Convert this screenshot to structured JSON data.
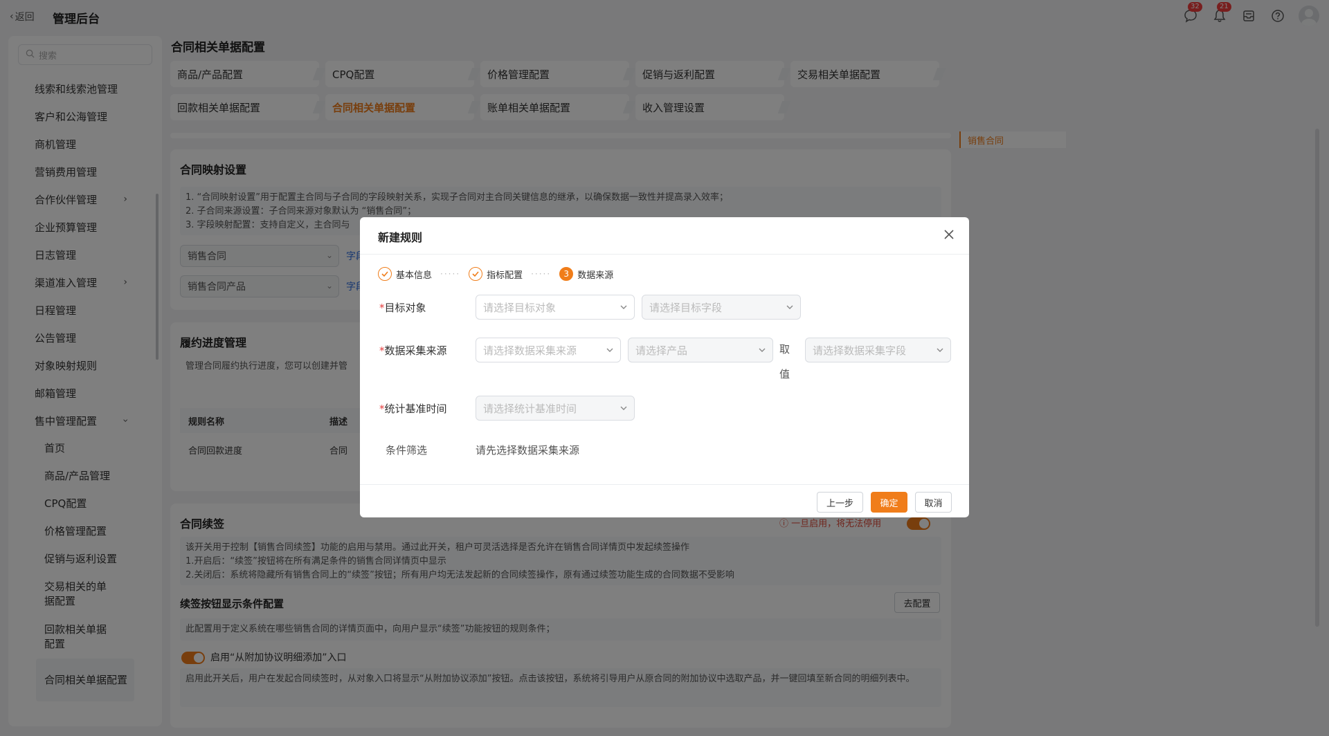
{
  "topbar": {
    "back_label": "返回",
    "app_title": "管理后台",
    "chat_badge": "32",
    "bell_badge": "21"
  },
  "sidebar": {
    "search_placeholder": "搜索",
    "items": [
      {
        "label": "线索和线索池管理"
      },
      {
        "label": "客户和公海管理"
      },
      {
        "label": "商机管理"
      },
      {
        "label": "营销费用管理"
      },
      {
        "label": "合作伙伴管理"
      },
      {
        "label": "企业预算管理"
      },
      {
        "label": "日志管理"
      },
      {
        "label": "渠道准入管理"
      },
      {
        "label": "日程管理"
      },
      {
        "label": "公告管理"
      },
      {
        "label": "对象映射规则"
      },
      {
        "label": "邮箱管理"
      },
      {
        "label": "售中管理配置"
      }
    ],
    "sub_items": [
      {
        "label": "首页"
      },
      {
        "label": "商品/产品管理"
      },
      {
        "label": "CPQ配置"
      },
      {
        "label": "价格管理配置"
      },
      {
        "label": "促销与返利设置"
      },
      {
        "label": "交易相关的单据配置"
      },
      {
        "label": "回款相关单据配置"
      },
      {
        "label": "合同相关单据配置"
      }
    ],
    "collapse_glyph": "«"
  },
  "main": {
    "title": "合同相关单据配置",
    "tabs": [
      {
        "label": "商品/产品配置"
      },
      {
        "label": "CPQ配置"
      },
      {
        "label": "价格管理配置"
      },
      {
        "label": "促销与返利配置"
      },
      {
        "label": "交易相关单据配置"
      },
      {
        "label": "回款相关单据配置"
      },
      {
        "label": "合同相关单据配置"
      },
      {
        "label": "账单相关单据配置"
      },
      {
        "label": "收入管理设置"
      }
    ],
    "right_nav_active": "销售合同",
    "mapping": {
      "title": "合同映射设置",
      "desc_1": "1. “合同映射设置”用于配置主合同与子合同的字段映射关系，实现子合同对主合同关键信息的继承，以确保数据一致性并提高录入效率；",
      "desc_2": "2. 子合同来源设置：子合同来源对象默认为 “销售合同”；",
      "desc_3": "3. 字段映射配置：支持自定义，主合同与",
      "select_1": "销售合同",
      "select_2": "销售合同产品",
      "link_1": "字段",
      "link_2": "字段"
    },
    "progress": {
      "title": "履约进度管理",
      "desc": "管理合同履约执行进度，您可以创建并管",
      "col_name": "规则名称",
      "col_desc": "描述",
      "row_name": "合同回款进度",
      "row_desc": "合同"
    },
    "renewal": {
      "title": "合同续签",
      "warning": "一旦启用，将无法停用",
      "desc_1": "该开关用于控制【销售合同续签】功能的启用与禁用。通过此开关，租户可灵活选择是否允许在销售合同详情页中发起续签操作",
      "desc_2": "1.开启后：“续签”按钮将在所有满足条件的销售合同详情页中显示",
      "desc_3": "2.关闭后：系统将隐藏所有销售合同上的“续签”按钮；所有用户均无法发起新的合同续签操作，原有通过续签功能生成的合同数据不受影响",
      "cond_title": "续签按钮显示条件配置",
      "cond_button": "去配置",
      "cond_desc": "此配置用于定义系统在哪些销售合同的详情页面中，向用户显示“续签”功能按钮的规则条件；",
      "addon_label": "启用“从附加协议明细添加”入口",
      "addon_desc": "启用此开关后，用户在发起合同续签时，从对象入口将显示“从附加协议添加”按钮。点击该按钮，系统将引导用户从原合同的附加协议中选取产品，并一键回填至新合同的明细列表中。"
    }
  },
  "modal": {
    "title": "新建规则",
    "steps": [
      {
        "label": "基本信息",
        "state": "done"
      },
      {
        "label": "指标配置",
        "state": "done"
      },
      {
        "label": "数据来源",
        "state": "current",
        "number": "3"
      }
    ],
    "fields": {
      "target_label": "目标对象",
      "target_object_placeholder": "请选择目标对象",
      "target_field_placeholder": "请选择目标字段",
      "source_label": "数据采集来源",
      "source_placeholder": "请选择数据采集来源",
      "product_placeholder": "请选择产品",
      "take_value_label_1": "取",
      "take_value_label_2": "值",
      "source_field_placeholder": "请选择数据采集字段",
      "time_label": "统计基准时间",
      "time_placeholder": "请选择统计基准时间",
      "filter_label": "条件筛选",
      "filter_hint": "请先选择数据采集来源"
    },
    "buttons": {
      "prev": "上一步",
      "confirm": "确定",
      "cancel": "取消"
    },
    "required_mark": "*"
  },
  "colors": {
    "accent": "#f07d1a",
    "link": "#2f6fe0",
    "badge": "#f03d3d"
  }
}
